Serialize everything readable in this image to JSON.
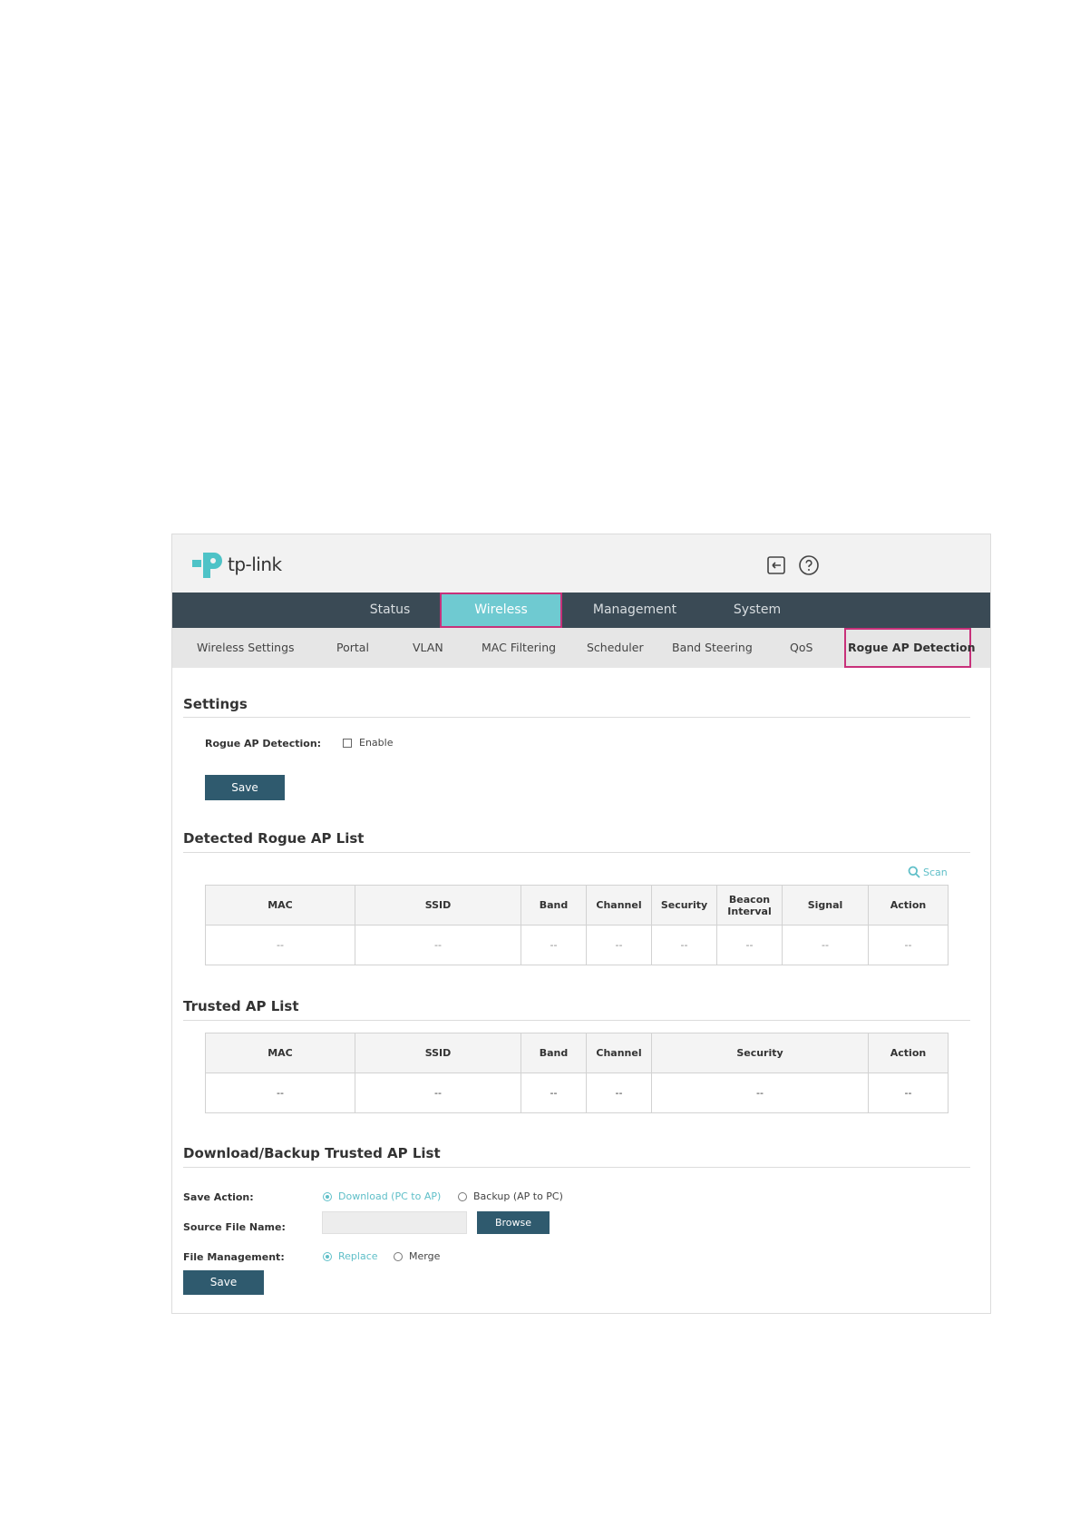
{
  "header": {
    "logo_text": "tp-link",
    "logout_icon": "logout-icon",
    "help_icon": "help-icon"
  },
  "nav": {
    "tabs": [
      {
        "label": "Status"
      },
      {
        "label": "Wireless",
        "active": true
      },
      {
        "label": "Management"
      },
      {
        "label": "System"
      }
    ]
  },
  "subnav": {
    "items": [
      {
        "label": "Wireless Settings"
      },
      {
        "label": "Portal"
      },
      {
        "label": "VLAN"
      },
      {
        "label": "MAC Filtering"
      },
      {
        "label": "Scheduler"
      },
      {
        "label": "Band Steering"
      },
      {
        "label": "QoS"
      },
      {
        "label": "Rogue AP Detection",
        "active": true
      }
    ]
  },
  "settings": {
    "title": "Settings",
    "rogue_label": "Rogue AP Detection:",
    "enable_label": "Enable",
    "enable_checked": false,
    "save_label": "Save"
  },
  "detected": {
    "title": "Detected Rogue AP List",
    "scan_label": "Scan",
    "columns": [
      "MAC",
      "SSID",
      "Band",
      "Channel",
      "Security",
      "Beacon Interval",
      "Signal",
      "Action"
    ],
    "rows": [
      [
        "--",
        "--",
        "--",
        "--",
        "--",
        "--",
        "--",
        "--"
      ]
    ]
  },
  "trusted": {
    "title": "Trusted AP List",
    "columns": [
      "MAC",
      "SSID",
      "Band",
      "Channel",
      "Security",
      "Action"
    ],
    "rows": [
      [
        "--",
        "--",
        "--",
        "--",
        "--",
        "--"
      ]
    ]
  },
  "download": {
    "title": "Download/Backup Trusted AP List",
    "save_action_label": "Save Action:",
    "save_action_options": [
      "Download (PC to AP)",
      "Backup (AP to PC)"
    ],
    "save_action_selected": "Download (PC to AP)",
    "source_file_label": "Source File Name:",
    "source_file_value": "",
    "browse_label": "Browse",
    "file_mgmt_label": "File Management:",
    "file_mgmt_options": [
      "Replace",
      "Merge"
    ],
    "file_mgmt_selected": "Replace",
    "save_label": "Save"
  },
  "colors": {
    "nav_bg": "#3a4a55",
    "active_tab": "#6fcad1",
    "highlight_border": "#c8317a",
    "button": "#2f5a6e",
    "accent": "#5fbfc8"
  }
}
